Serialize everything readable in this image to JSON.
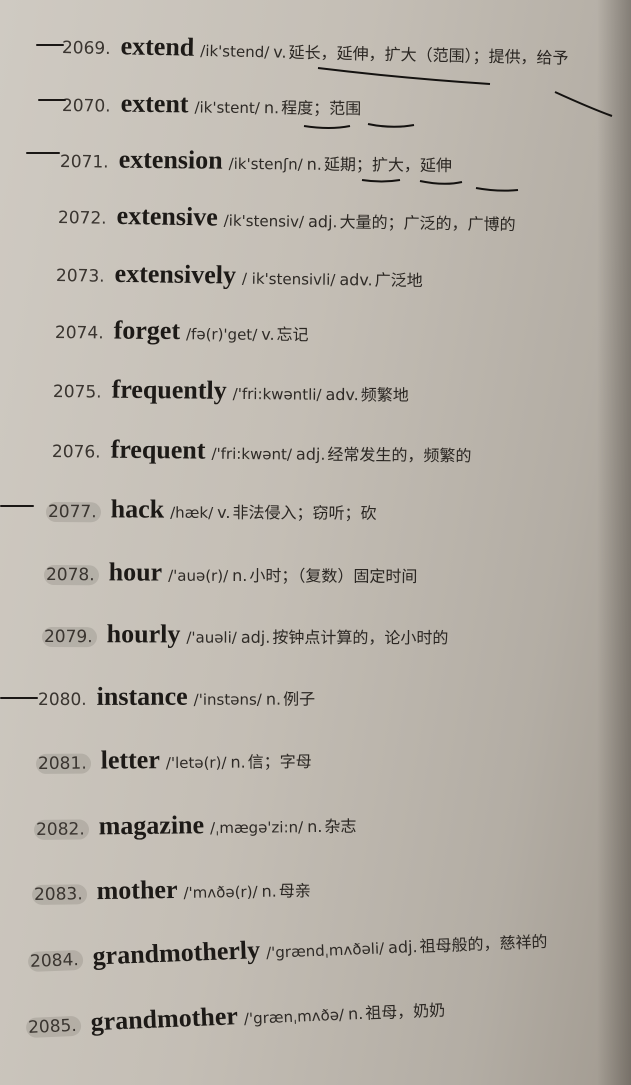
{
  "entries": [
    {
      "num": "2069.",
      "word": "extend",
      "ipa": "/ik'stend/",
      "pos": "v.",
      "def": "延长，延伸，扩大（范围）；提供，给予"
    },
    {
      "num": "2070.",
      "word": "extent",
      "ipa": "/ik'stent/",
      "pos": "n.",
      "def": "程度；范围"
    },
    {
      "num": "2071.",
      "word": "extension",
      "ipa": "/ik'stenʃn/",
      "pos": "n.",
      "def": "延期；扩大，延伸"
    },
    {
      "num": "2072.",
      "word": "extensive",
      "ipa": "/ik'stensiv/",
      "pos": "adj.",
      "def": "大量的；广泛的，广博的"
    },
    {
      "num": "2073.",
      "word": "extensively",
      "ipa": "/ ik'stensivli/",
      "pos": "adv.",
      "def": "广泛地"
    },
    {
      "num": "2074.",
      "word": "forget",
      "ipa": "/fə(r)'get/",
      "pos": "v.",
      "def": "忘记"
    },
    {
      "num": "2075.",
      "word": "frequently",
      "ipa": "/'fri:kwəntli/",
      "pos": "adv.",
      "def": "频繁地"
    },
    {
      "num": "2076.",
      "word": "frequent",
      "ipa": "/'fri:kwənt/",
      "pos": "adj.",
      "def": "经常发生的，频繁的"
    },
    {
      "num": "2077.",
      "word": "hack",
      "ipa": "/hæk/",
      "pos": "v.",
      "def": "非法侵入；窃听；砍"
    },
    {
      "num": "2078.",
      "word": "hour",
      "ipa": "/'auə(r)/",
      "pos": "n.",
      "def": "小时；（复数）固定时间"
    },
    {
      "num": "2079.",
      "word": "hourly",
      "ipa": "/'auəli/",
      "pos": "adj.",
      "def": "按钟点计算的，论小时的"
    },
    {
      "num": "2080.",
      "word": "instance",
      "ipa": "/'instəns/",
      "pos": "n.",
      "def": "例子"
    },
    {
      "num": "2081.",
      "word": "letter",
      "ipa": "/'letə(r)/",
      "pos": "n.",
      "def": "信；字母"
    },
    {
      "num": "2082.",
      "word": "magazine",
      "ipa": "/ˌmægə'zi:n/",
      "pos": "n.",
      "def": "杂志"
    },
    {
      "num": "2083.",
      "word": "mother",
      "ipa": "/'mʌðə(r)/",
      "pos": "n.",
      "def": "母亲"
    },
    {
      "num": "2084.",
      "word": "grandmotherly",
      "ipa": "/'grændˌmʌðəli/",
      "pos": "adj.",
      "def": "祖母般的，慈祥的"
    },
    {
      "num": "2085.",
      "word": "grandmother",
      "ipa": "/'grænˌmʌðə/",
      "pos": "n.",
      "def": "祖母，奶奶"
    }
  ],
  "colors": {
    "paper": "#c8c2ba",
    "ink": "#1d1a17",
    "pen": "#141210"
  }
}
